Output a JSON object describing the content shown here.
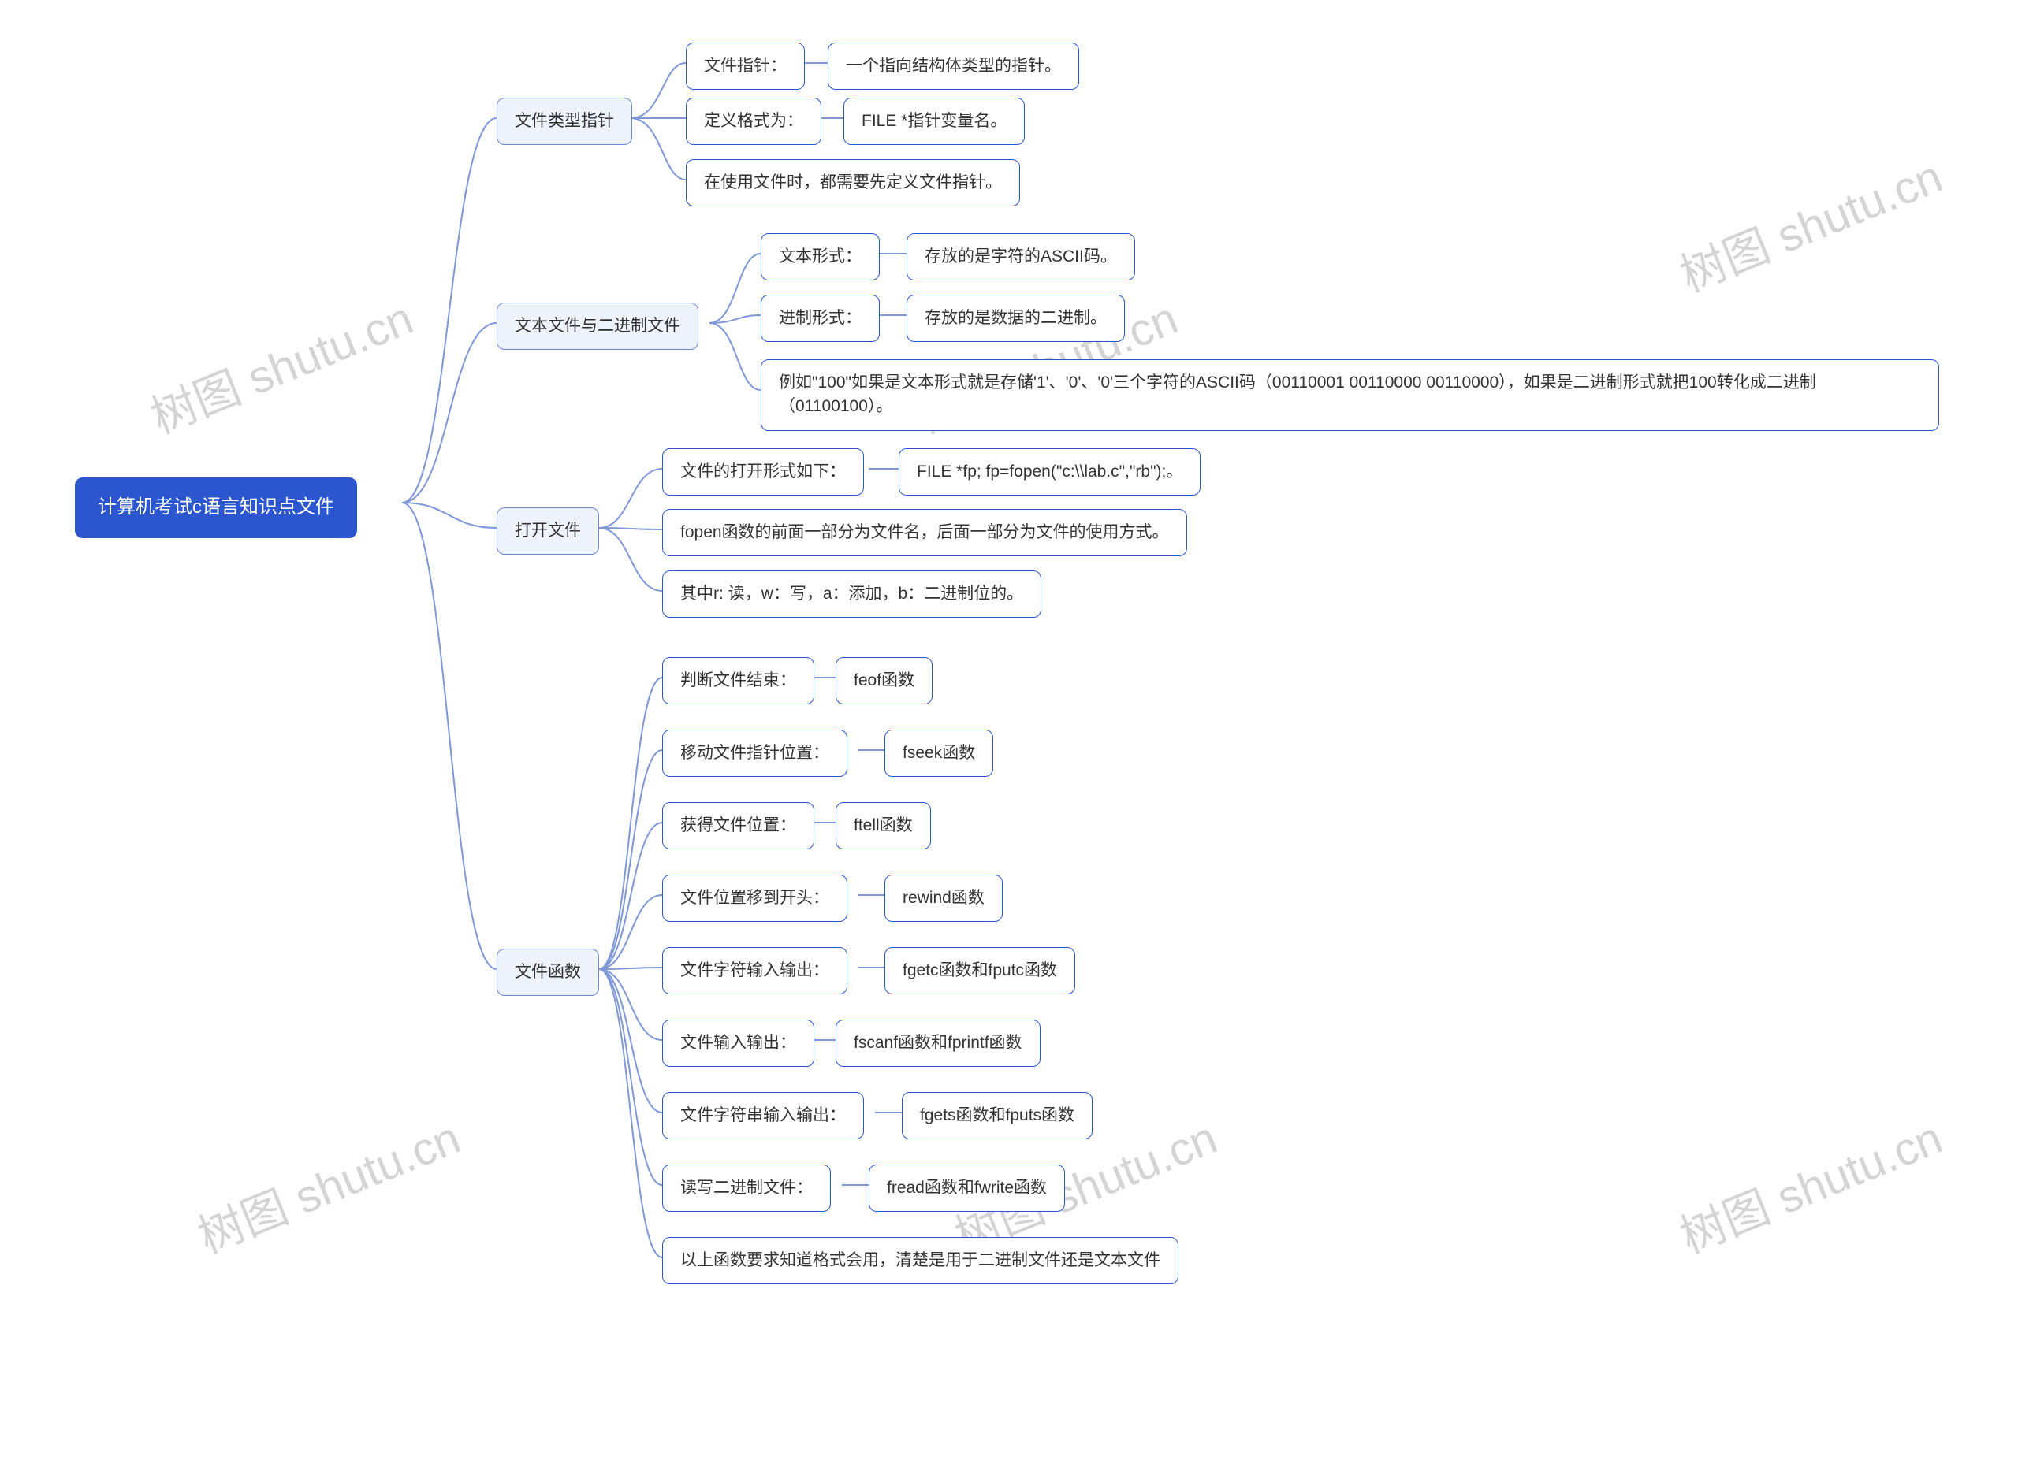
{
  "watermark": "树图 shutu.cn",
  "root": "计算机考试c语言知识点文件",
  "branches": {
    "b1": {
      "title": "文件类型指针",
      "n1": {
        "a": "文件指针：",
        "b": "一个指向结构体类型的指针。"
      },
      "n2": {
        "a": "定义格式为：",
        "b": "FILE *指针变量名。"
      },
      "n3": "在使用文件时，都需要先定义文件指针。"
    },
    "b2": {
      "title": "文本文件与二进制文件",
      "n1": {
        "a": "文本形式：",
        "b": "存放的是字符的ASCII码。"
      },
      "n2": {
        "a": "进制形式：",
        "b": "存放的是数据的二进制。"
      },
      "n3": "例如\"100\"如果是文本形式就是存储'1'、'0'、'0'三个字符的ASCII码（00110001 00110000 00110000），如果是二进制形式就把100转化成二进制（01100100）。"
    },
    "b3": {
      "title": "打开文件",
      "n1": {
        "a": "文件的打开形式如下：",
        "b": "FILE *fp;  fp=fopen(\"c:\\\\lab.c\",\"rb\");。"
      },
      "n2": "fopen函数的前面一部分为文件名，后面一部分为文件的使用方式。",
      "n3": "其中r: 读，w：写，a：添加，b：二进制位的。"
    },
    "b4": {
      "title": "文件函数",
      "n1": {
        "a": "判断文件结束：",
        "b": "feof函数"
      },
      "n2": {
        "a": "移动文件指针位置：",
        "b": "fseek函数"
      },
      "n3": {
        "a": "获得文件位置：",
        "b": "ftell函数"
      },
      "n4": {
        "a": "文件位置移到开头：",
        "b": "rewind函数"
      },
      "n5": {
        "a": "文件字符输入输出：",
        "b": "fgetc函数和fputc函数"
      },
      "n6": {
        "a": "文件输入输出：",
        "b": "fscanf函数和fprintf函数"
      },
      "n7": {
        "a": "文件字符串输入输出：",
        "b": "fgets函数和fputs函数"
      },
      "n8": {
        "a": "读写二进制文件：",
        "b": "fread函数和fwrite函数"
      },
      "n9": "以上函数要求知道格式会用，清楚是用于二进制文件还是文本文件"
    }
  }
}
